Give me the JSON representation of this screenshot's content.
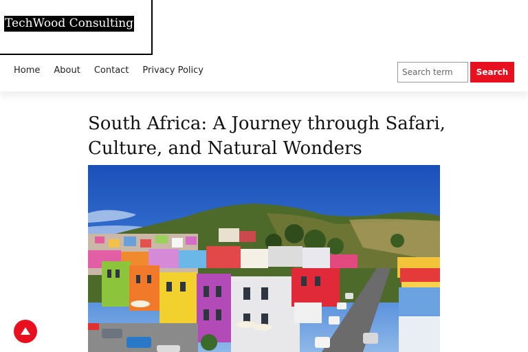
{
  "site": {
    "name": "TechWood Consulting"
  },
  "nav": {
    "items": [
      "Home",
      "About",
      "Contact",
      "Privacy Policy"
    ]
  },
  "search": {
    "placeholder": "Search term",
    "button_label": "Search"
  },
  "article": {
    "title": "South Africa: A Journey through Safari, Culture, and Natural Wonders",
    "hero_description": "Colorful Bo-Kaap houses in Cape Town with hill behind"
  },
  "colors": {
    "accent": "#e8101f",
    "text": "#111111"
  },
  "icons": {
    "scroll_top": "arrow-up-icon",
    "search": "search-icon"
  }
}
